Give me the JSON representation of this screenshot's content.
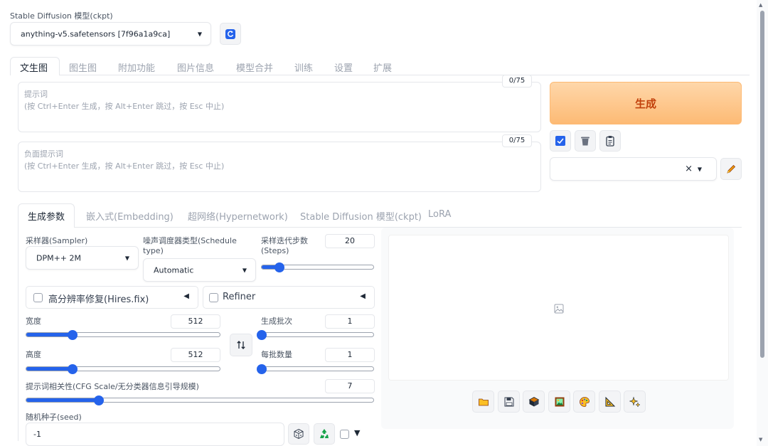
{
  "model": {
    "label": "Stable Diffusion 模型(ckpt)",
    "value": "anything-v5.safetensors [7f96a1a9ca]"
  },
  "main_tabs": [
    "文生图",
    "图生图",
    "附加功能",
    "图片信息",
    "模型合并",
    "训练",
    "设置",
    "扩展"
  ],
  "prompt": {
    "label": "提示词",
    "hint": "(按 Ctrl+Enter 生成，按 Alt+Enter 跳过，按 Esc 中止)",
    "counter": "0/75"
  },
  "negative_prompt": {
    "label": "负面提示词",
    "hint": "(按 Ctrl+Enter 生成，按 Alt+Enter 跳过，按 Esc 中止)",
    "counter": "0/75"
  },
  "generate_label": "生成",
  "style_select": {
    "clear_symbol": "×"
  },
  "sub_tabs": [
    "生成参数",
    "嵌入式(Embedding)",
    "超网络(Hypernetwork)",
    "Stable Diffusion 模型(ckpt)",
    "LoRA"
  ],
  "sampler": {
    "label": "采样器(Sampler)",
    "value": "DPM++ 2M"
  },
  "schedule": {
    "label_line1": "噪声调度器类型(Schedule",
    "label_line2": "type)",
    "value": "Automatic"
  },
  "steps": {
    "label_line1": "采样迭代步数",
    "label_line2": "(Steps)",
    "value": "20",
    "fraction": 0.16
  },
  "hires": {
    "label": "高分辨率修复(Hires.fix)",
    "arrow": "◀"
  },
  "refiner": {
    "label": "Refiner",
    "arrow": "◀"
  },
  "width": {
    "label": "宽度",
    "value": "512",
    "fraction": 0.24
  },
  "height": {
    "label": "高度",
    "value": "512",
    "fraction": 0.24
  },
  "batch_count": {
    "label": "生成批次",
    "value": "1",
    "fraction": 0.0
  },
  "batch_size": {
    "label": "每批数量",
    "value": "1",
    "fraction": 0.0
  },
  "cfg": {
    "label": "提示词相关性(CFG Scale/无分类器信息引导规模)",
    "value": "7",
    "fraction": 0.21
  },
  "seed": {
    "label": "随机种子(seed)",
    "value": "-1",
    "extra_arrow": "▼"
  },
  "colors": {
    "accent": "#2563eb",
    "generate_text": "#c2410c",
    "generate_bg_top": "#fed7aa",
    "generate_bg_bottom": "#fdba74"
  }
}
